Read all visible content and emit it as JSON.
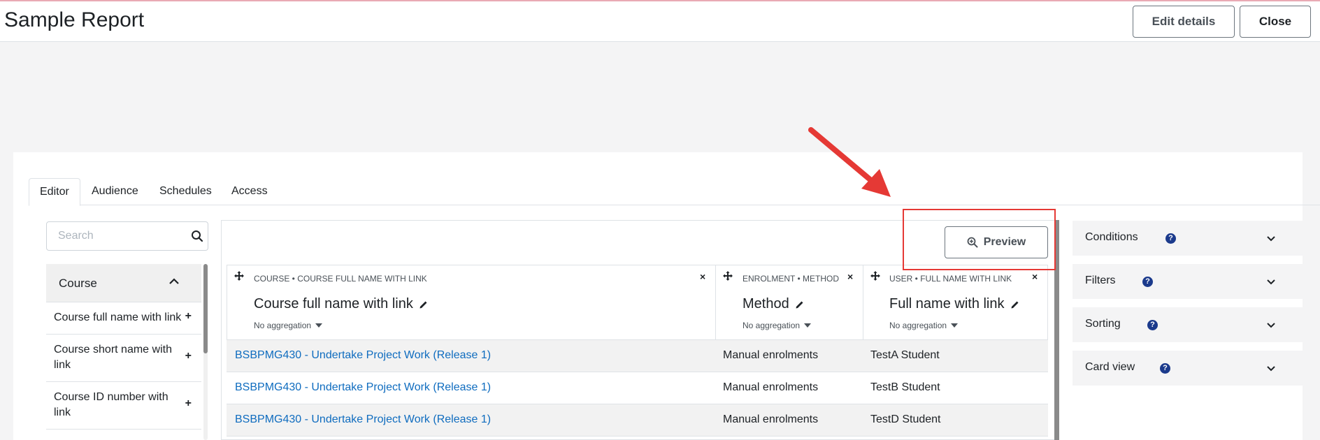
{
  "header": {
    "title": "Sample Report",
    "edit_label": "Edit details",
    "close_label": "Close"
  },
  "tabs": [
    {
      "label": "Editor",
      "active": true
    },
    {
      "label": "Audience",
      "active": false
    },
    {
      "label": "Schedules",
      "active": false
    },
    {
      "label": "Access",
      "active": false
    }
  ],
  "sidebar": {
    "search_placeholder": "Search",
    "section": {
      "label": "Course",
      "expanded": true
    },
    "items": [
      {
        "label": "Course full name with link"
      },
      {
        "label": "Course short name with link"
      },
      {
        "label": "Course ID number with link"
      }
    ]
  },
  "toolbar": {
    "preview_label": "Preview"
  },
  "columns": [
    {
      "meta": "COURSE • COURSE FULL NAME WITH LINK",
      "name": "Course full name with link",
      "aggregation": "No aggregation"
    },
    {
      "meta": "ENROLMENT • METHOD",
      "name": "Method",
      "aggregation": "No aggregation"
    },
    {
      "meta": "USER • FULL NAME WITH LINK",
      "name": "Full name with link",
      "aggregation": "No aggregation"
    }
  ],
  "rows": [
    {
      "course": "BSBPMG430 - Undertake Project Work (Release 1)",
      "method": "Manual enrolments",
      "user": "TestA Student"
    },
    {
      "course": "BSBPMG430 - Undertake Project Work (Release 1)",
      "method": "Manual enrolments",
      "user": "TestB Student"
    },
    {
      "course": "BSBPMG430 - Undertake Project Work (Release 1)",
      "method": "Manual enrolments",
      "user": "TestD Student"
    }
  ],
  "panels": [
    {
      "label": "Conditions",
      "help_icon": "question-circle-icon"
    },
    {
      "label": "Filters",
      "help_icon": "question-circle-icon"
    },
    {
      "label": "Sorting",
      "help_icon": "question-circle-icon"
    },
    {
      "label": "Card view",
      "help_icon": "question-circle-icon"
    }
  ],
  "colors": {
    "link": "#0f6cbf",
    "annotation": "#e53935",
    "help": "#1b3a8c"
  }
}
